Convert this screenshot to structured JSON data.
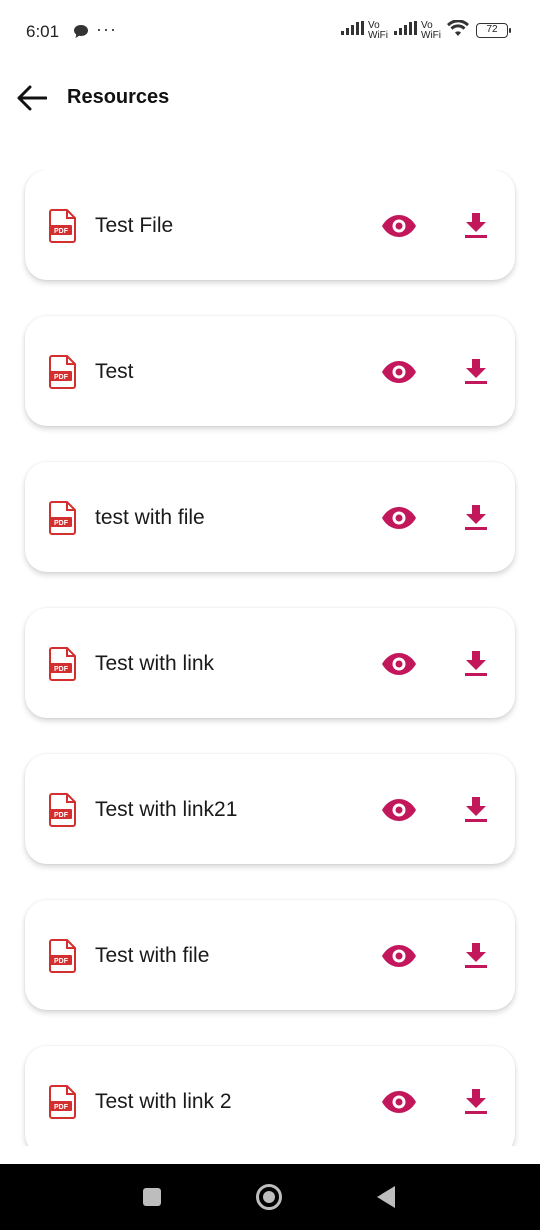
{
  "status_bar": {
    "time": "6:01",
    "dots": "···",
    "vo_label_1": "Vo",
    "wifi_label_1": "WiFi",
    "vo_label_2": "Vo",
    "wifi_label_2": "WiFi",
    "battery": "72"
  },
  "header": {
    "title": "Resources"
  },
  "resources": [
    {
      "title": "Test File"
    },
    {
      "title": "Test"
    },
    {
      "title": "test with file"
    },
    {
      "title": "Test with link"
    },
    {
      "title": "Test with link21"
    },
    {
      "title": "Test with file"
    },
    {
      "title": "Test with link 2"
    }
  ],
  "icons": {
    "pdf": "pdf-file-icon",
    "view": "eye-icon",
    "download": "download-icon",
    "back": "arrow-left-icon"
  },
  "colors": {
    "accent": "#C2185B",
    "pdf_red": "#D32F2F"
  }
}
